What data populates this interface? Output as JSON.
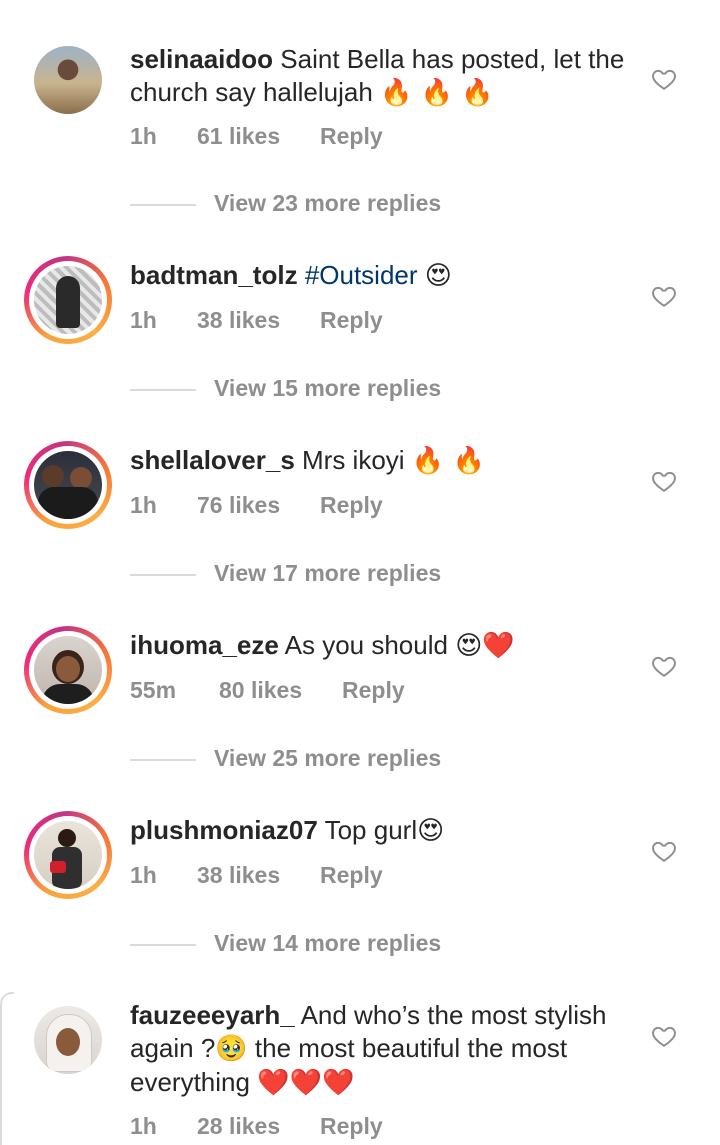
{
  "comments": [
    {
      "user": "selinaaidoo",
      "text": "Saint Bella has posted, let the church say hallelujah",
      "emoji": "🔥 🔥 🔥",
      "time": "1h",
      "likes": "61 likes",
      "reply": "Reply",
      "view_replies": "View 23 more replies"
    },
    {
      "user": "badtman_tolz",
      "hashtag": "#Outsider",
      "emoji": "😍",
      "time": "1h",
      "likes": "38 likes",
      "reply": "Reply",
      "view_replies": "View 15 more replies"
    },
    {
      "user": "shellalover_s",
      "text": "Mrs ikoyi",
      "emoji": "🔥 🔥",
      "time": "1h",
      "likes": "76 likes",
      "reply": "Reply",
      "view_replies": "View 17 more replies"
    },
    {
      "user": "ihuoma_eze",
      "text": "As you should",
      "emoji": "😍❤️",
      "time": "55m",
      "likes": "80 likes",
      "reply": "Reply",
      "view_replies": "View 25 more replies"
    },
    {
      "user": "plushmoniaz07",
      "text": "Top gurl",
      "emoji": "😍",
      "time": "1h",
      "likes": "38 likes",
      "reply": "Reply",
      "view_replies": "View 14 more replies"
    },
    {
      "user": "fauzeeeyarh_",
      "text": "And who’s the most stylish again ?",
      "emoji_mid": "🥹",
      "text2": "the most beautiful the most everything",
      "emoji": "❤️❤️❤️",
      "time": "1h",
      "likes": "28 likes",
      "reply": "Reply"
    }
  ],
  "icons": {
    "like": "heart-outline-icon",
    "avatar": "avatar-photo"
  },
  "colors": {
    "username": "#262626",
    "meta": "#8e8e8e",
    "hashtag": "#00376b",
    "story_ring": "#ee2a7b"
  }
}
